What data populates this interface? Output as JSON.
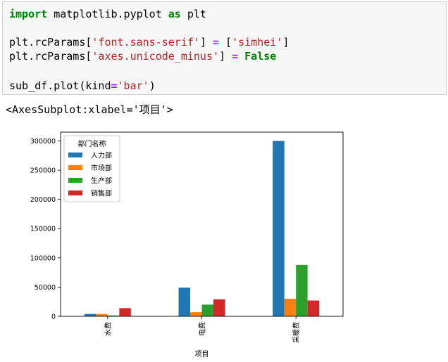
{
  "code": {
    "line1": {
      "kw1": "import",
      "mid": " matplotlib.pyplot ",
      "kw2": "as",
      "end": " plt"
    },
    "line2": {
      "a": "plt.rcParams[",
      "s1": "'font.sans-serif'",
      "b": "] ",
      "eq": "=",
      "c": " [",
      "s2": "'simhei'",
      "d": "]"
    },
    "line3": {
      "a": "plt.rcParams[",
      "s1": "'axes.unicode_minus'",
      "b": "] ",
      "eq": "=",
      "c": " ",
      "kw": "False"
    },
    "line4": {
      "a": "sub_df.plot(kind",
      "eq": "=",
      "s1": "'bar'",
      "b": ")"
    }
  },
  "output_repr": "<AxesSubplot:xlabel='项目'>",
  "chart_data": {
    "type": "bar",
    "categories": [
      "水费",
      "电费",
      "采暖费"
    ],
    "series": [
      {
        "name": "人力部",
        "color": "#1f77b4",
        "values": [
          4000,
          49000,
          300000
        ]
      },
      {
        "name": "市场部",
        "color": "#ff7f0e",
        "values": [
          4000,
          7000,
          30000
        ]
      },
      {
        "name": "生产部",
        "color": "#2ca02c",
        "values": [
          1500,
          20000,
          88000
        ]
      },
      {
        "name": "销售部",
        "color": "#d62728",
        "values": [
          14000,
          29000,
          27000
        ]
      }
    ],
    "legend_title": "部门名称",
    "legend_position": "top-left",
    "xlabel": "项目",
    "ylabel": "",
    "ylim": [
      0,
      315000
    ],
    "yticks": [
      0,
      50000,
      100000,
      150000,
      200000,
      250000,
      300000
    ],
    "ytick_labels": [
      "0",
      "50000",
      "100000",
      "150000",
      "200000",
      "250000",
      "300000"
    ]
  }
}
